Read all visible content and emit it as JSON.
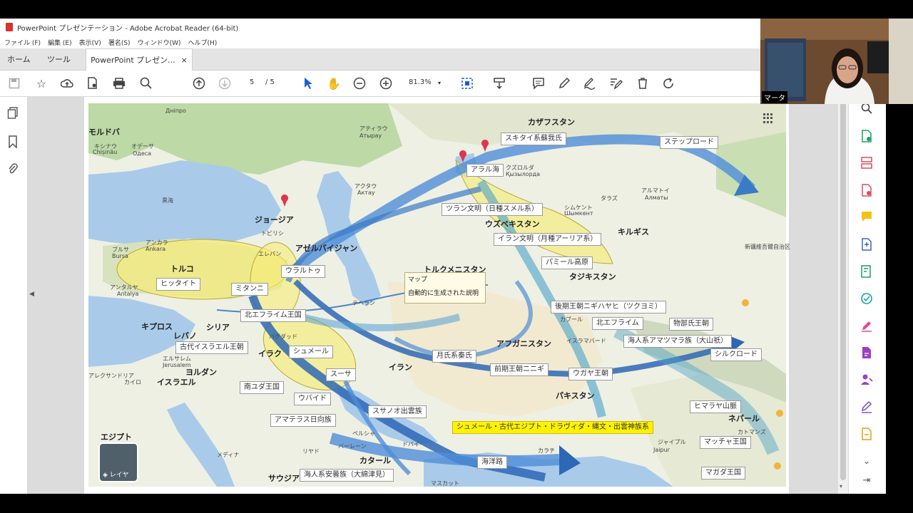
{
  "window": {
    "title": "PowerPoint プレゼンテーション - Adobe Acrobat Reader (64-bit)"
  },
  "menu": [
    "ファイル (F)",
    "編集 (E)",
    "表示(V)",
    "署名(S)",
    "ウィンドウ(W)",
    "ヘルプ(H)"
  ],
  "tabs": {
    "home": "ホーム",
    "tools": "ツール",
    "document": "PowerPoint プレゼン...",
    "close": "×"
  },
  "toolbar": {
    "page_current": "5",
    "page_total": "/ 5",
    "zoom": "81.3%"
  },
  "webcam": {
    "name": "マータ"
  },
  "map": {
    "countries": {
      "kazakhstan": "カザフスタン",
      "uzbekistan": "ウズベキスタン",
      "kyrgyzstan": "キルギス",
      "tajikistan": "タジキスタン",
      "turkmenistan": "トルクメニスタン",
      "georgia": "ジョージア",
      "azerbaijan": "アゼルバイジャン",
      "turkey": "トルコ",
      "syria": "シリア",
      "iraq": "イラク",
      "iran": "イラン",
      "afghanistan": "アフガニスタン",
      "pakistan": "パキスタン",
      "jordan": "ヨルダン",
      "israel": "イスラエル",
      "egypt": "エジプト",
      "saudi": "サウジア",
      "qatar": "カタール",
      "cyprus": "キプロス",
      "lebanon": "レバノ",
      "moldova": "モルドバ",
      "nepal": "ネパール"
    },
    "cities": {
      "kishinau": "キシナウ",
      "chisinau": "Chișinău",
      "odesa_jp": "オデーサ",
      "odesa": "Одеса",
      "dnipro": "Дніпро",
      "atyrau_jp": "アティラウ",
      "atyrau": "Атырау",
      "aktau_jp": "アクタウ",
      "aktau": "Актау",
      "kyzylorda_jp": "クズロルダ",
      "kyzylorda": "Қызылорда",
      "shymkent_jp": "シムケント",
      "shymkent": "Шымкент",
      "taraz": "タラズ",
      "almaty_jp": "アルマトイ",
      "almaty": "Алматы",
      "ankara_jp": "アンカラ",
      "ankara": "Ankara",
      "bursa_jp": "ブルサ",
      "bursa": "Bursa",
      "antalya_jp": "アンタルヤ",
      "antalya": "Antalya",
      "tbilisi_jp": "トビリシ",
      "yerevan_jp": "エレバン",
      "tehran_jp": "テヘラン",
      "baghdad_jp": "バグダッド",
      "kabul_jp": "カブール",
      "islamabad_jp": "イスラマバード",
      "jerusalem_jp": "エルサレム",
      "jerusalem": "Jerusalem",
      "cairo_jp": "カイロ",
      "medina_jp": "メディナ",
      "riyadh_jp": "リヤド",
      "bahrain_jp": "バーレーン",
      "dubai_jp": "ドバイ",
      "karachi_jp": "カラチ",
      "muscat_jp": "マスカット",
      "jaipur": "Jaipur",
      "jaipur_jp": "ジャイプル",
      "kathmandu_jp": "カトマンズ",
      "xinjiang": "新疆維吾爾自治区",
      "alexandria_jp": "アレクサンドリア",
      "blacksea": "黒海",
      "persia": "ペルシャ"
    },
    "labels": {
      "scythian": "スキタイ系蘇我氏",
      "steppe": "ステップロード",
      "aral": "アラル海",
      "turan": "ツラン文明（日種スメル系）",
      "iran_civ": "イラン文明（月種アーリア系）",
      "pamir": "パミール高原",
      "ural": "ウラルトゥ",
      "hittite": "ヒッタイト",
      "mitanni": "ミタンニ",
      "north_ephraim_kingdom": "北エフライム王国",
      "later_dynasty": "後期王朝ニギハヤヒ（ツクヨミ）",
      "north_ephraim": "北エフライム",
      "mononobe": "物部氏王朝",
      "ancient_israel": "古代イスラエル王朝",
      "sumer": "シュメール",
      "amatsumara": "海人系アマツマラ族（大山祇）",
      "silk_road": "シルクロード",
      "yuezhi": "月氏系秦氏",
      "susa": "スーサ",
      "early_dynasty": "前期王朝ニニギ",
      "ugaya": "ウガヤ王朝",
      "south_judah": "南ユダ王国",
      "ubaid": "ウバイド",
      "susanoo": "スサノオ出雲族",
      "himalaya": "ヒマラヤ山脈",
      "amaterasu": "アマテラス日向族",
      "sumer_egypt": "シュメール・古代エジプト・ドラヴィダ・縄文・出雲神族系",
      "matsya": "マッチャ王国",
      "sea_route": "海洋路",
      "magadha": "マガダ王国",
      "azumi": "海人系安曇族（大綿津見）"
    },
    "popup": {
      "title": "マップ",
      "body": "自動的に生成された説明"
    },
    "layer_button": "レイヤ"
  }
}
